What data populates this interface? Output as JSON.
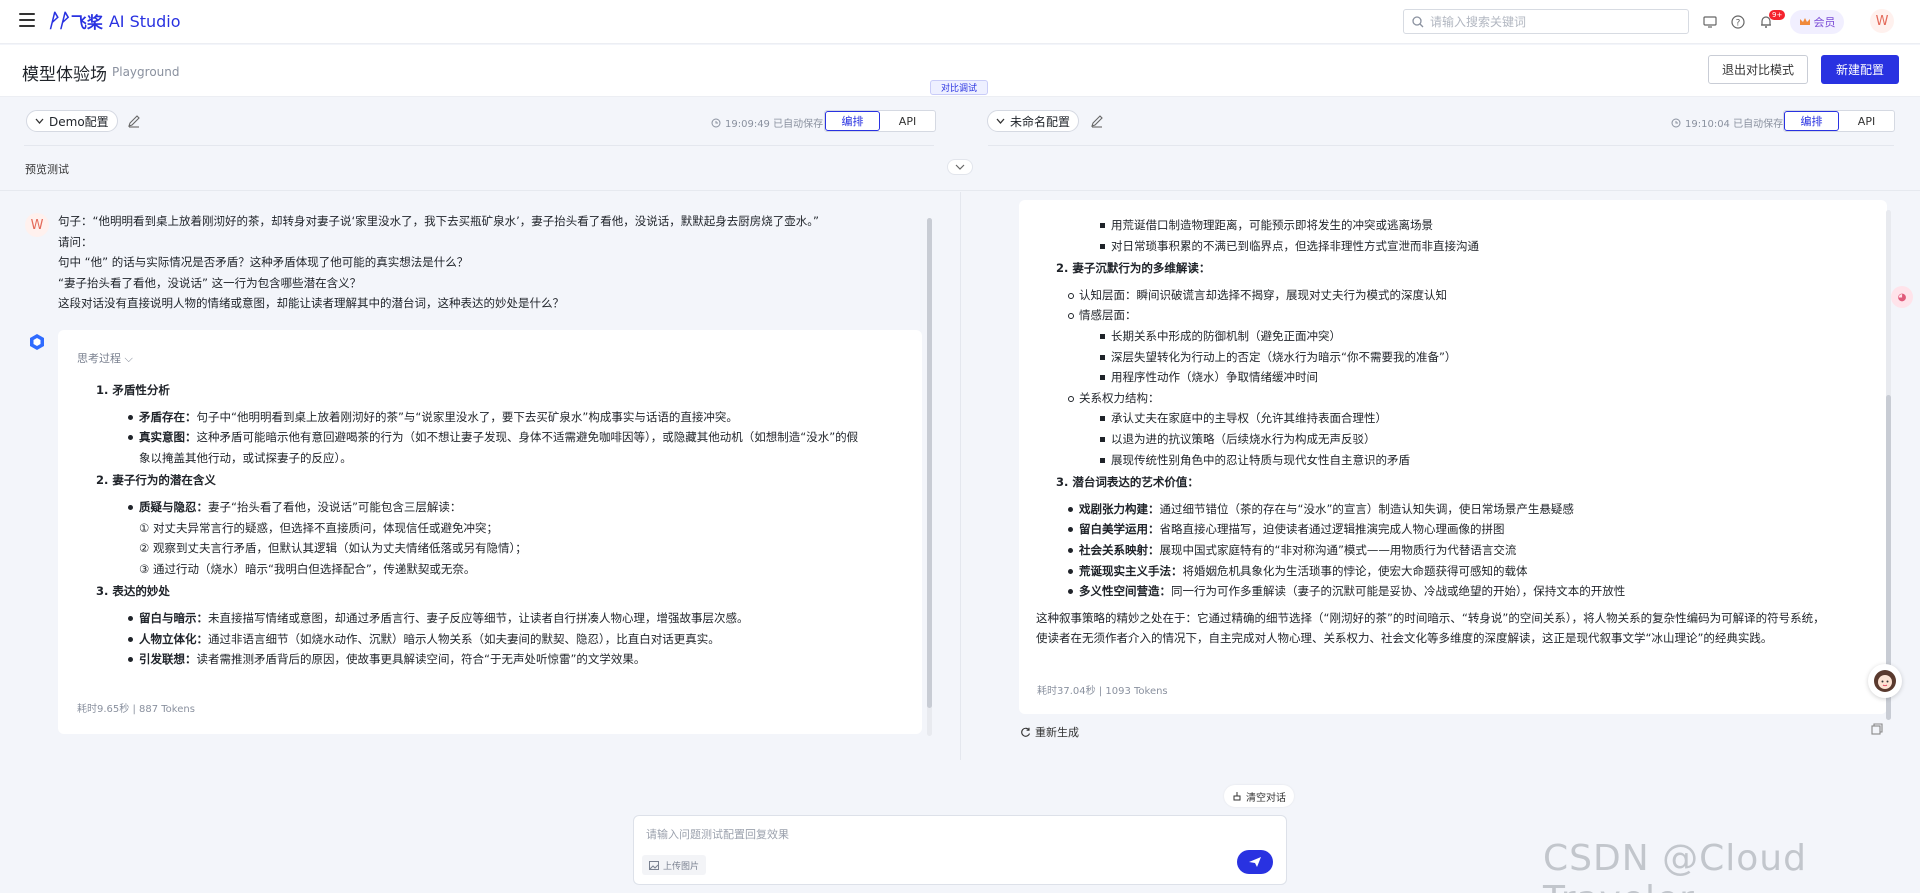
{
  "topbar": {
    "logo_mark": "ᚹᚹ",
    "brand": "飞桨",
    "product": "AI Studio",
    "search_placeholder": "请输入搜索关键词",
    "badge": "9+",
    "vip_label": "会员",
    "avatar_letter": "W"
  },
  "header": {
    "title": "模型体验场",
    "subtitle": "Playground",
    "exit_button": "退出对比模式",
    "new_button": "新建配置",
    "compare_tag": "对比调试"
  },
  "left_config": {
    "name": "Demo配置",
    "autosave": "19:09:49 已自动保存",
    "tab_arrange": "编排",
    "tab_api": "API"
  },
  "right_config": {
    "name": "未命名配置",
    "autosave": "19:10:04 已自动保存",
    "tab_arrange": "编排",
    "tab_api": "API"
  },
  "preview": {
    "title": "预览测试"
  },
  "user": {
    "avatar_letter": "W",
    "lines": [
      "句子：“他明明看到桌上放着刚沏好的茶，却转身对妻子说‘家里没水了，我下去买瓶矿泉水’，妻子抬头看了看他，没说话，默默起身去厨房烧了壶水。”",
      "请问：",
      "句中 “他” 的话与实际情况是否矛盾？这种矛盾体现了他可能的真实想法是什么？",
      "“妻子抬头看了看他，没说话” 这一行为包含哪些潜在含义？",
      "这段对话没有直接说明人物的情绪或意图，却能让读者理解其中的潜台词，这种表达的妙处是什么？"
    ]
  },
  "left_answer": {
    "thinking": "思考过程",
    "h1": "1. 矛盾性分析",
    "s1a_b": "矛盾存在：",
    "s1a": "句子中“他明明看到桌上放着刚沏好的茶”与“说家里没水了，要下去买矿泉水”构成事实与话语的直接冲突。",
    "s1b_b": "真实意图：",
    "s1b1": "这种矛盾可能暗示他有意回避喝茶的行为（如不想让妻子发现、身体不适需避免咖啡因等），或隐藏其他动机（如想制造“没水”的假",
    "s1b2": "象以掩盖其他行动，或试探妻子的反应）。",
    "h2": "2. 妻子行为的潜在含义",
    "s2a_b": "质疑与隐忍：",
    "s2a": "妻子“抬头看了看他，没说话”可能包含三层解读：",
    "s2a1": "① 对丈夫异常言行的疑惑，但选择不直接质问，体现信任或避免冲突；",
    "s2a2": "② 观察到丈夫言行矛盾，但默认其逻辑（如认为丈夫情绪低落或另有隐情）；",
    "s2a3": "③ 通过行动（烧水）暗示“我明白但选择配合”，传递默契或无奈。",
    "h3": "3. 表达的妙处",
    "s3a_b": "留白与暗示：",
    "s3a": "未直接描写情绪或意图，却通过矛盾言行、妻子反应等细节，让读者自行拼凑人物心理，增强故事层次感。",
    "s3b_b": "人物立体化：",
    "s3b": "通过非语言细节（如烧水动作、沉默）暗示人物关系（如夫妻间的默契、隐忍），比直白对话更真实。",
    "s3c_b": "引发联想：",
    "s3c": "读者需推测矛盾背后的原因，使故事更具解读空间，符合“于无声处听惊雷”的文学效果。",
    "meta": "耗时9.65秒 | 887 Tokens"
  },
  "right_answer": {
    "p0a": "用荒诞借口制造物理距离，可能预示即将发生的冲突或逃离场景",
    "p0b": "对日常琐事积累的不满已到临界点，但选择非理性方式宣泄而非直接沟通",
    "h2": "2. 妻子沉默行为的多维解读：",
    "cog": "认知层面：瞬间识破谎言却选择不揭穿，展现对丈夫行为模式的深度认知",
    "emo": "情感层面：",
    "emo1": "长期关系中形成的防御机制（避免正面冲突）",
    "emo2": "深层失望转化为行动上的否定（烧水行为暗示“你不需要我的准备”）",
    "emo3": "用程序性动作（烧水）争取情绪缓冲时间",
    "pow": "关系权力结构：",
    "pow1": "承认丈夫在家庭中的主导权（允许其维持表面合理性）",
    "pow2": "以退为进的抗议策略（后续烧水行为构成无声反驳）",
    "pow3": "展现传统性别角色中的忍让特质与现代女性自主意识的矛盾",
    "h3": "3. 潜台词表达的艺术价值：",
    "a1_b": "戏剧张力构建：",
    "a1": "通过细节错位（茶的存在与“没水”的宣言）制造认知失调，使日常场景产生悬疑感",
    "a2_b": "留白美学运用：",
    "a2": "省略直接心理描写，迫使读者通过逻辑推演完成人物心理画像的拼图",
    "a3_b": "社会关系映射：",
    "a3": "展现中国式家庭特有的“非对称沟通”模式——用物质行为代替语言交流",
    "a4_b": "荒诞现实主义手法：",
    "a4": "将婚姻危机具象化为生活琐事的悖论，使宏大命题获得可感知的载体",
    "a5_b": "多义性空间营造：",
    "a5": "同一行为可作多重解读（妻子的沉默可能是妥协、冷战或绝望的开始），保持文本的开放性",
    "con1": "这种叙事策略的精妙之处在于：它通过精确的细节选择（“刚沏好的茶”的时间暗示、“转身说”的空间关系），将人物关系的复杂性编码为可解译的符号系统，",
    "con2": "使读者在无须作者介入的情况下，自主完成对人物心理、关系权力、社会文化等多维度的深度解读，这正是现代叙事文学“冰山理论”的经典实践。",
    "meta": "耗时37.04秒 | 1093 Tokens",
    "regen": "重新生成"
  },
  "input": {
    "placeholder": "请输入问题测试配置回复效果",
    "upload": "上传图片",
    "clear": "清空对话"
  },
  "watermark": "CSDN @Cloud Traveler",
  "colors": {
    "accent": "#2932e1",
    "bg": "#f3f5fa"
  }
}
